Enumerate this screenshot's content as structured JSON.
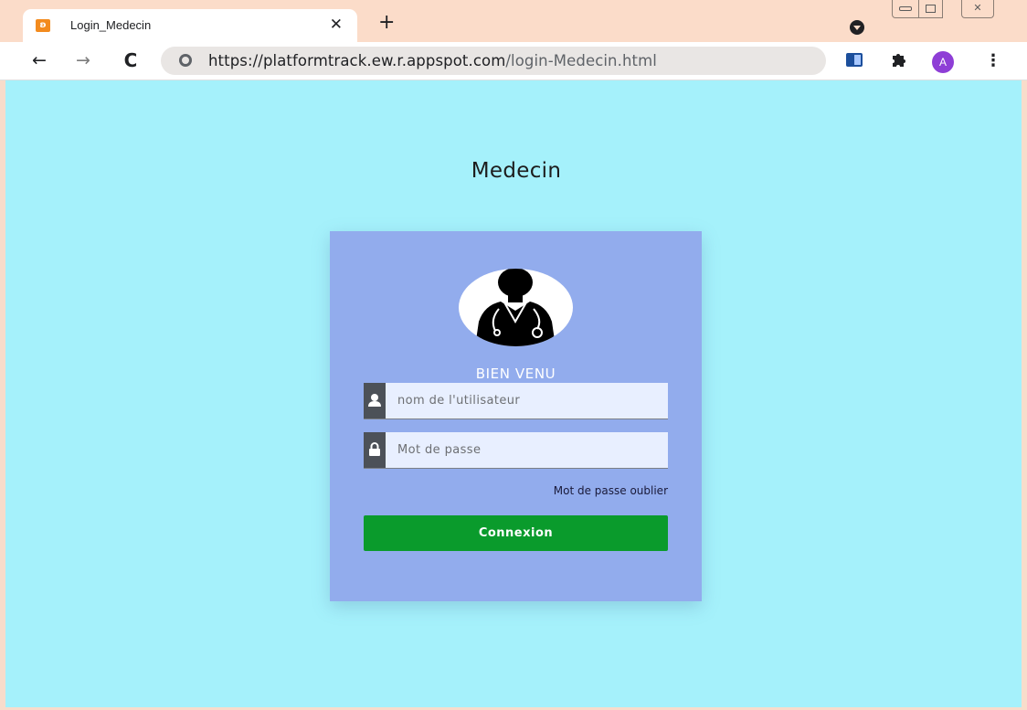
{
  "browser": {
    "tab": {
      "title": "Login_Medecin",
      "favicon": "xampp-icon",
      "close_icon": "close-icon"
    },
    "new_tab_icon": "plus-icon",
    "url": {
      "scheme": "https://",
      "host": "platformtrack.ew.r.appspot.com",
      "path": "/login-Medecin.html"
    },
    "avatar_letter": "A",
    "nav": {
      "back": "←",
      "forward": "→",
      "reload": "C"
    },
    "accent_colors": {
      "page_background": "#a5f1fb",
      "card": "#92aced",
      "button": "#0a9b2c"
    }
  },
  "page": {
    "title": "Medecin",
    "welcome": "BIEN VENU",
    "username": {
      "placeholder": "nom de l'utilisateur",
      "value": "",
      "icon": "user-icon"
    },
    "password": {
      "placeholder": "Mot de passe",
      "value": "",
      "icon": "lock-icon"
    },
    "forgot_link": "Mot de passe oublier",
    "submit_label": "Connexion",
    "avatar_icon": "doctor-icon"
  }
}
